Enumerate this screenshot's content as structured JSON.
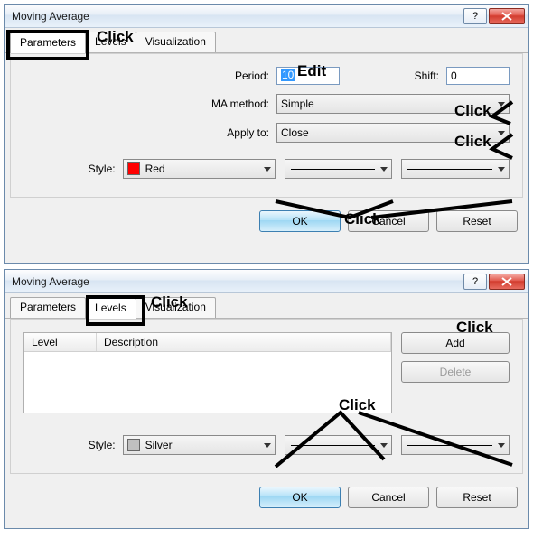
{
  "dialog1": {
    "title": "Moving Average",
    "tabs": [
      "Parameters",
      "Levels",
      "Visualization"
    ],
    "active_tab": 0,
    "period_label": "Period:",
    "period_value": "10",
    "shift_label": "Shift:",
    "shift_value": "0",
    "ma_method_label": "MA method:",
    "ma_method_value": "Simple",
    "apply_to_label": "Apply to:",
    "apply_to_value": "Close",
    "style_label": "Style:",
    "style_color_name": "Red",
    "style_color_hex": "#ff0000",
    "buttons": {
      "ok": "OK",
      "cancel": "Cancel",
      "reset": "Reset"
    },
    "annotations": {
      "click_tabs": "Click",
      "edit": "Edit",
      "click_ma": "Click",
      "click_apply": "Click",
      "click_style": "Click"
    }
  },
  "dialog2": {
    "title": "Moving Average",
    "tabs": [
      "Parameters",
      "Levels",
      "Visualization"
    ],
    "active_tab": 1,
    "list_headers": {
      "level": "Level",
      "description": "Description"
    },
    "add_label": "Add",
    "delete_label": "Delete",
    "style_label": "Style:",
    "style_color_name": "Silver",
    "style_color_hex": "#c0c0c0",
    "buttons": {
      "ok": "OK",
      "cancel": "Cancel",
      "reset": "Reset"
    },
    "annotations": {
      "click_tabs": "Click",
      "click_add": "Click",
      "click_style": "Click"
    }
  }
}
